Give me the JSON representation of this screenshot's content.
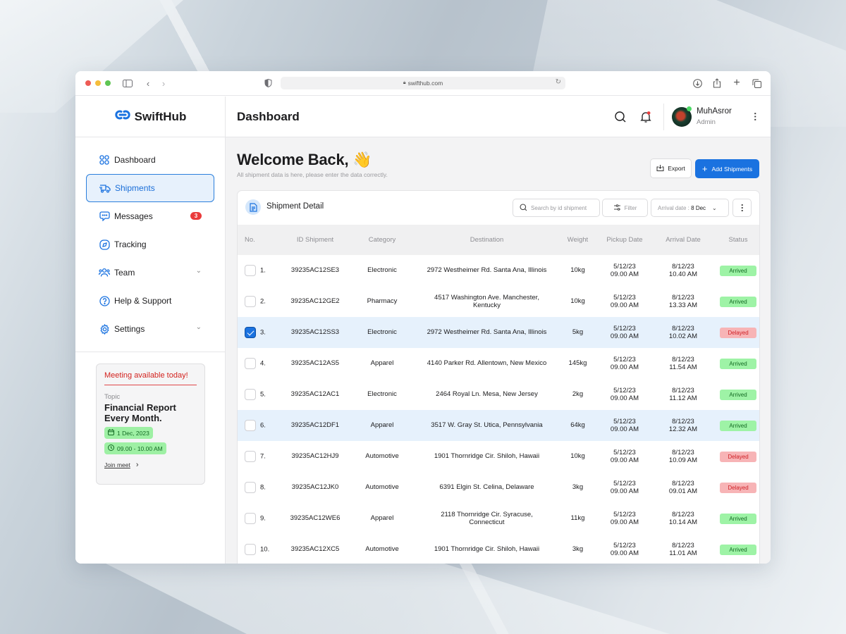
{
  "browser": {
    "url": "swifthub.com"
  },
  "brand": {
    "name": "SwiftHub",
    "accent": "#1a72e0"
  },
  "topbar": {
    "title": "Dashboard",
    "user": {
      "name": "MuhAsror",
      "role": "Admin"
    }
  },
  "sidebar": {
    "items": [
      {
        "label": "Dashboard",
        "icon": "grid-icon",
        "active": false
      },
      {
        "label": "Shipments",
        "icon": "truck-icon",
        "active": true
      },
      {
        "label": "Messages",
        "icon": "chat-icon",
        "badge": "3"
      },
      {
        "label": "Tracking",
        "icon": "compass-icon"
      },
      {
        "label": "Team",
        "icon": "team-icon",
        "expandable": true
      },
      {
        "label": "Help & Support",
        "icon": "help-icon"
      },
      {
        "label": "Settings",
        "icon": "gear-icon",
        "expandable": true
      }
    ],
    "meeting": {
      "title": "Meeting available today!",
      "topic_label": "Topic",
      "topic": "Financial Report Every Month.",
      "date": "1 Dec, 2023",
      "time": "09.00 - 10.00 AM",
      "join_label": "Join meet"
    }
  },
  "welcome": {
    "title": "Welcome Back, 👋",
    "subtitle": "All shipment data is here, please enter the data correctly."
  },
  "actions": {
    "export": "Export",
    "add": "Add Shipments"
  },
  "card": {
    "title": "Shipment Detail",
    "search_placeholder": "Search by id shipment",
    "filter": "Filter",
    "arrival_label": "Arrival date : ",
    "arrival_value": "8 Dec"
  },
  "table": {
    "columns": [
      "No.",
      "ID Shipment",
      "Category",
      "Destination",
      "Weight",
      "Pickup Date",
      "Arrival Date",
      "Status"
    ],
    "rows": [
      {
        "no": "1.",
        "id": "39235AC12SE3",
        "category": "Electronic",
        "destination": "2972 Westheimer Rd. Santa Ana, Illinois",
        "weight": "10kg",
        "pickup_date": "5/12/23",
        "pickup_time": "09.00 AM",
        "arrival_date": "8/12/23",
        "arrival_time": "10.40 AM",
        "status": "Arrived",
        "checked": false,
        "highlight": false
      },
      {
        "no": "2.",
        "id": "39235AC12GE2",
        "category": "Pharmacy",
        "destination": "4517 Washington Ave. Manchester, Kentucky",
        "weight": "10kg",
        "pickup_date": "5/12/23",
        "pickup_time": "09.00 AM",
        "arrival_date": "8/12/23",
        "arrival_time": "13.33 AM",
        "status": "Arrived",
        "checked": false,
        "highlight": false
      },
      {
        "no": "3.",
        "id": "39235AC12SS3",
        "category": "Electronic",
        "destination": "2972 Westheimer Rd. Santa Ana, Illinois",
        "weight": "5kg",
        "pickup_date": "5/12/23",
        "pickup_time": "09.00 AM",
        "arrival_date": "8/12/23",
        "arrival_time": "10.02 AM",
        "status": "Delayed",
        "checked": true,
        "highlight": true
      },
      {
        "no": "4.",
        "id": "39235AC12AS5",
        "category": "Apparel",
        "destination": "4140 Parker Rd. Allentown, New Mexico",
        "weight": "145kg",
        "pickup_date": "5/12/23",
        "pickup_time": "09.00 AM",
        "arrival_date": "8/12/23",
        "arrival_time": "11.54 AM",
        "status": "Arrived",
        "checked": false,
        "highlight": false
      },
      {
        "no": "5.",
        "id": "39235AC12AC1",
        "category": "Electronic",
        "destination": "2464 Royal Ln. Mesa, New Jersey",
        "weight": "2kg",
        "pickup_date": "5/12/23",
        "pickup_time": "09.00 AM",
        "arrival_date": "8/12/23",
        "arrival_time": "11.12 AM",
        "status": "Arrived",
        "checked": false,
        "highlight": false
      },
      {
        "no": "6.",
        "id": "39235AC12DF1",
        "category": "Apparel",
        "destination": "3517 W. Gray St. Utica, Pennsylvania",
        "weight": "64kg",
        "pickup_date": "5/12/23",
        "pickup_time": "09.00 AM",
        "arrival_date": "8/12/23",
        "arrival_time": "12.32 AM",
        "status": "Arrived",
        "checked": false,
        "highlight": true
      },
      {
        "no": "7.",
        "id": "39235AC12HJ9",
        "category": "Automotive",
        "destination": "1901 Thornridge Cir. Shiloh, Hawaii",
        "weight": "10kg",
        "pickup_date": "5/12/23",
        "pickup_time": "09.00 AM",
        "arrival_date": "8/12/23",
        "arrival_time": "10.09 AM",
        "status": "Delayed",
        "checked": false,
        "highlight": false
      },
      {
        "no": "8.",
        "id": "39235AC12JK0",
        "category": "Automotive",
        "destination": "6391 Elgin St. Celina, Delaware",
        "weight": "3kg",
        "pickup_date": "5/12/23",
        "pickup_time": "09.00 AM",
        "arrival_date": "8/12/23",
        "arrival_time": "09.01 AM",
        "status": "Delayed",
        "checked": false,
        "highlight": false
      },
      {
        "no": "9.",
        "id": "39235AC12WE6",
        "category": "Apparel",
        "destination": "2118 Thornridge Cir. Syracuse, Connecticut",
        "weight": "11kg",
        "pickup_date": "5/12/23",
        "pickup_time": "09.00 AM",
        "arrival_date": "8/12/23",
        "arrival_time": "10.14 AM",
        "status": "Arrived",
        "checked": false,
        "highlight": false
      },
      {
        "no": "10.",
        "id": "39235AC12XC5",
        "category": "Automotive",
        "destination": "1901 Thornridge Cir. Shiloh, Hawaii",
        "weight": "3kg",
        "pickup_date": "5/12/23",
        "pickup_time": "09.00 AM",
        "arrival_date": "8/12/23",
        "arrival_time": "11.01 AM",
        "status": "Arrived",
        "checked": false,
        "highlight": false
      }
    ]
  }
}
